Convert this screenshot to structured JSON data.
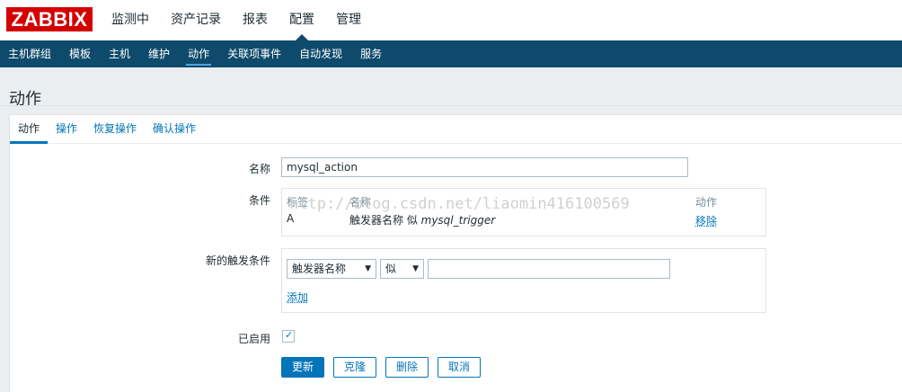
{
  "logo": "ZABBIX",
  "top_menu": [
    {
      "label": "监测中"
    },
    {
      "label": "资产记录"
    },
    {
      "label": "报表"
    },
    {
      "label": "配置"
    },
    {
      "label": "管理"
    }
  ],
  "sub_menu": [
    {
      "label": "主机群组"
    },
    {
      "label": "模板"
    },
    {
      "label": "主机"
    },
    {
      "label": "维护"
    },
    {
      "label": "动作"
    },
    {
      "label": "关联项事件"
    },
    {
      "label": "自动发现"
    },
    {
      "label": "服务"
    }
  ],
  "page_title": "动作",
  "tabs": [
    {
      "label": "动作"
    },
    {
      "label": "操作"
    },
    {
      "label": "恢复操作"
    },
    {
      "label": "确认操作"
    }
  ],
  "form": {
    "name_label": "名称",
    "name_value": "mysql_action",
    "conditions_label": "条件",
    "conditions": {
      "headers": {
        "tag": "标签",
        "name": "名称",
        "action": "动作"
      },
      "rows": [
        {
          "tag": "A",
          "name_prefix": "触发器名称 似 ",
          "name_value": "mysql_trigger",
          "action": "移除"
        }
      ]
    },
    "new_condition_label": "新的触发条件",
    "new_condition": {
      "type_select": "触发器名称",
      "operator_select": "似",
      "value": "",
      "add_link": "添加"
    },
    "enabled_label": "已启用",
    "enabled": true
  },
  "buttons": {
    "update": "更新",
    "clone": "克隆",
    "delete": "删除",
    "cancel": "取消"
  },
  "watermark": "http://blog.csdn.net/liaomin416100569",
  "colors": {
    "brand_red": "#d40000",
    "nav_blue": "#0e4a6b",
    "link_blue": "#0275b8"
  }
}
